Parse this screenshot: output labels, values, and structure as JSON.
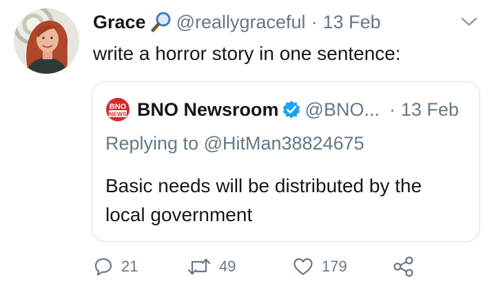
{
  "tweet": {
    "author_name": "Grace",
    "author_emoji": "search-icon",
    "handle": "@reallygraceful",
    "separator": "·",
    "date": "13 Feb",
    "text": "write a horror story in one sentence:"
  },
  "quote": {
    "logo_line1": "BNO",
    "logo_line2": "NEWS",
    "author_name": "BNO Newsroom",
    "handle": "@BNO...",
    "separator": "·",
    "date": "13 Feb",
    "replying_to": "Replying to @HitMan38824675",
    "text": "Basic needs will be distributed by the local government"
  },
  "actions": {
    "reply_count": "21",
    "retweet_count": "49",
    "like_count": "179"
  },
  "colors": {
    "text": "#14171a",
    "muted": "#657786",
    "border": "#d7dde2",
    "verified": "#1da1f2",
    "bno_red": "#d6292d"
  }
}
